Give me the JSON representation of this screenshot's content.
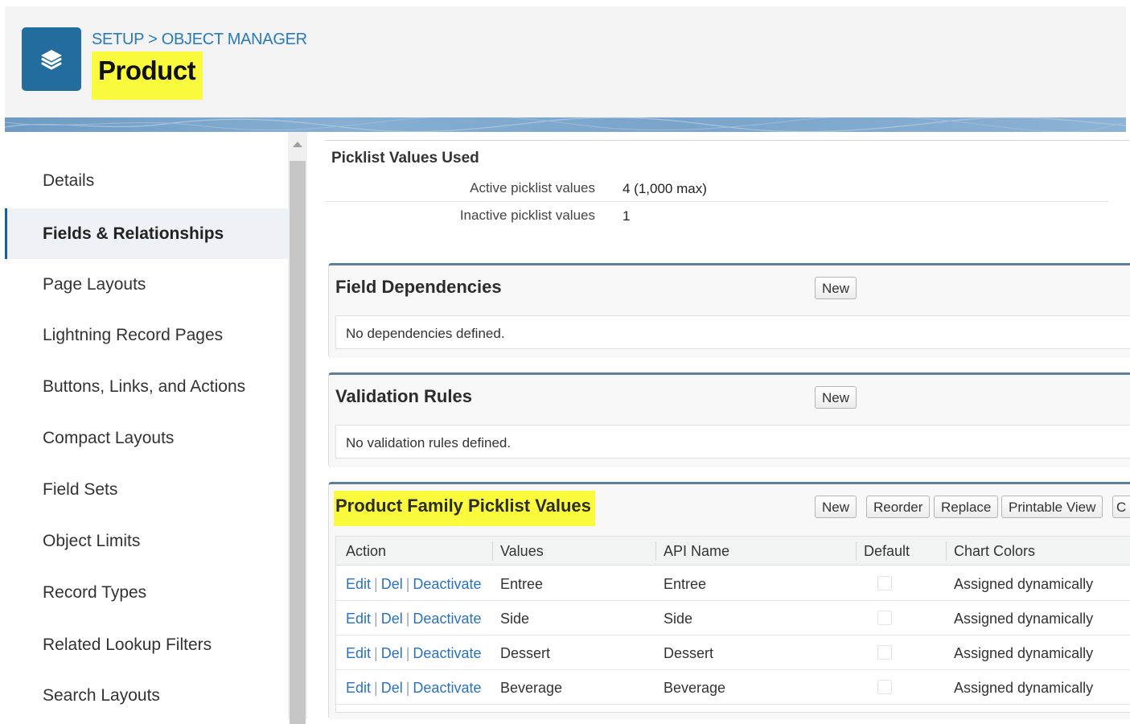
{
  "header": {
    "breadcrumb_setup": "SETUP",
    "breadcrumb_sep": ">",
    "breadcrumb_object_manager": "OBJECT MANAGER",
    "title": "Product",
    "app_icon": "layers-icon"
  },
  "sidebar": {
    "items": [
      {
        "label": "Details"
      },
      {
        "label": "Fields & Relationships",
        "active": true
      },
      {
        "label": "Page Layouts"
      },
      {
        "label": "Lightning Record Pages"
      },
      {
        "label": "Buttons, Links, and Actions"
      },
      {
        "label": "Compact Layouts"
      },
      {
        "label": "Field Sets"
      },
      {
        "label": "Object Limits"
      },
      {
        "label": "Record Types"
      },
      {
        "label": "Related Lookup Filters"
      },
      {
        "label": "Search Layouts"
      }
    ]
  },
  "picklist_usage": {
    "title": "Picklist Values Used",
    "active_label": "Active picklist values",
    "active_value": "4 (1,000 max)",
    "inactive_label": "Inactive picklist values",
    "inactive_value": "1"
  },
  "field_dependencies": {
    "title": "Field Dependencies",
    "new_label": "New",
    "empty_message": "No dependencies defined."
  },
  "validation_rules": {
    "title": "Validation Rules",
    "new_label": "New",
    "empty_message": "No validation rules defined."
  },
  "product_family": {
    "title": "Product Family Picklist Values",
    "buttons": {
      "new": "New",
      "reorder": "Reorder",
      "replace": "Replace",
      "printable_view": "Printable View",
      "cut_off": "C"
    },
    "columns": {
      "action": "Action",
      "values": "Values",
      "api_name": "API Name",
      "default": "Default",
      "chart_colors": "Chart Colors"
    },
    "actions": {
      "edit": "Edit",
      "del": "Del",
      "deactivate": "Deactivate",
      "sep": "|"
    },
    "rows": [
      {
        "value": "Entree",
        "api_name": "Entree",
        "default": false,
        "chart_color": "Assigned dynamically"
      },
      {
        "value": "Side",
        "api_name": "Side",
        "default": false,
        "chart_color": "Assigned dynamically"
      },
      {
        "value": "Dessert",
        "api_name": "Dessert",
        "default": false,
        "chart_color": "Assigned dynamically"
      },
      {
        "value": "Beverage",
        "api_name": "Beverage",
        "default": false,
        "chart_color": "Assigned dynamically"
      }
    ]
  },
  "colors": {
    "accent": "#236d9e",
    "link": "#2a72c0",
    "highlight": "#fbfb3e",
    "panel_border": "#5e7e99"
  }
}
